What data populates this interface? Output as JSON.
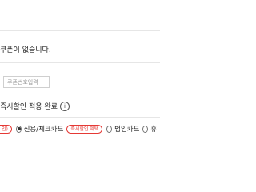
{
  "coupon": {
    "message": "쿠폰이 없습니다.",
    "input_placeholder": "쿠폰번호입력"
  },
  "discount_notice": {
    "text": "즉시할인 적용 완료",
    "info_icon": "i"
  },
  "payment": {
    "left_badge": "인)",
    "options": [
      {
        "label": "신용/체크카드",
        "selected": true,
        "badge": "즉시할인 혜택"
      },
      {
        "label": "법인카드",
        "selected": false
      },
      {
        "label": "휴",
        "selected": false
      }
    ]
  },
  "colors": {
    "badge": "#e53935",
    "divider": "#e6e6e6"
  }
}
